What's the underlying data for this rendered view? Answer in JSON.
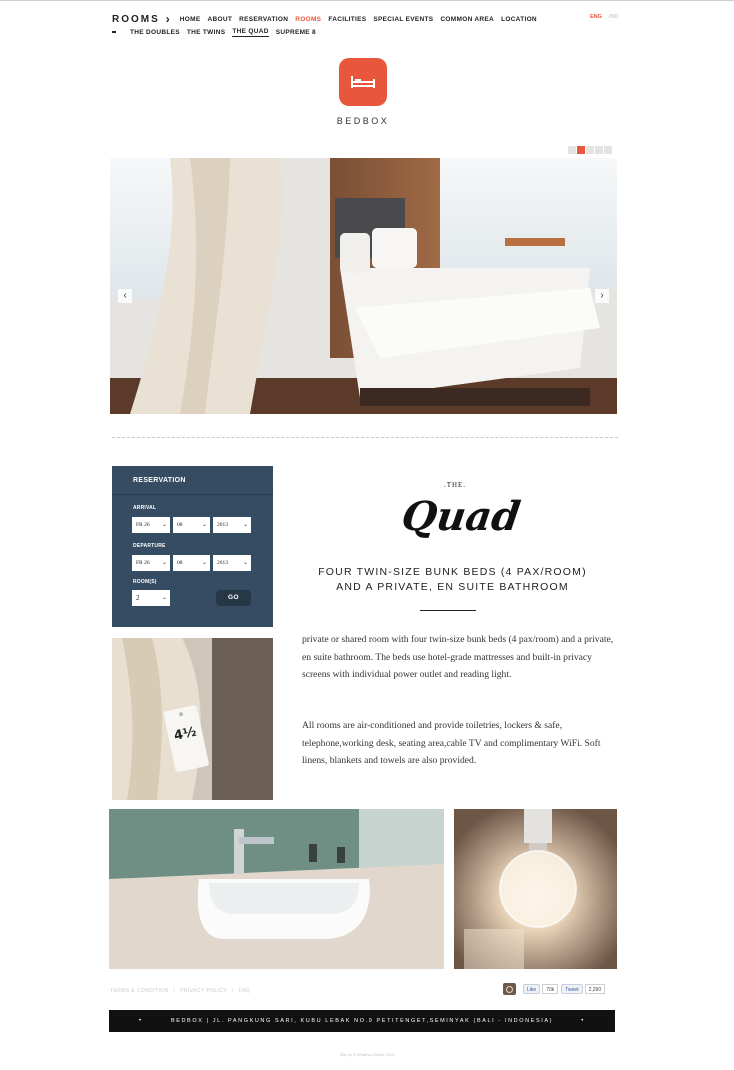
{
  "header": {
    "section_title": "ROOMS",
    "nav": [
      "HOME",
      "ABOUT",
      "RESERVATION",
      "ROOMS",
      "FACILITIES",
      "SPECIAL EVENTS",
      "COMMON AREA",
      "LOCATION"
    ],
    "nav_active": "ROOMS",
    "languages": [
      "ENG",
      "IND"
    ],
    "language_active": "ENG",
    "subnav": [
      "THE DOUBLES",
      "THE TWINS",
      "THE QUAD",
      "SUPREME 8"
    ],
    "subnav_active": "THE QUAD"
  },
  "brand": {
    "name": "BEDBOX",
    "accent_color": "#e8563c",
    "icon": "bed-icon"
  },
  "slider": {
    "slide_count": 5,
    "active_slide": 2,
    "prev_label": "‹",
    "next_label": "›"
  },
  "reservation": {
    "title": "RESERVATION",
    "arrival_label": "ARRIVAL",
    "arrival": {
      "day": "FR 26",
      "month": "08",
      "year": "2013"
    },
    "departure_label": "DEPARTURE",
    "departure": {
      "day": "FR 26",
      "month": "08",
      "year": "2013"
    },
    "rooms_label": "ROOM(S)",
    "rooms": "2",
    "go_label": "GO",
    "panel_color": "#354c62"
  },
  "room": {
    "the": ".THE.",
    "name": "Quad",
    "subtitle_line1": "FOUR TWIN-SIZE BUNK BEDS (4 PAX/ROOM)",
    "subtitle_line2": "AND A PRIVATE, EN SUITE BATHROOM",
    "paragraph1": "private or shared room with four twin-size bunk beds (4 pax/room) and a private, en suite bathroom. The beds use hotel-grade mattresses and built-in privacy screens with individual power outlet and reading light.",
    "paragraph2": "All rooms are air-conditioned and provide toiletries, lockers & safe, telephone,working desk, seating area,cable TV and complimentary WiFi. Soft linens, blankets and towels are also provided.",
    "tag_text": "4½"
  },
  "footer": {
    "links": [
      "TERMS & CONDITION",
      "PRIVACY POLICY",
      "FAQ"
    ],
    "separator": "/",
    "like_label": "Like",
    "like_count": "70k",
    "tweet_label": "Tweet",
    "tweet_count": "2,290",
    "address": "BEDBOX | JL. PANGKUNG SARI, KUBU LEBAK NO.9 PETITENGET,SEMINYAK (BALI - INDONESIA)",
    "credit": "Site by © Whatnot Studio 2013"
  }
}
